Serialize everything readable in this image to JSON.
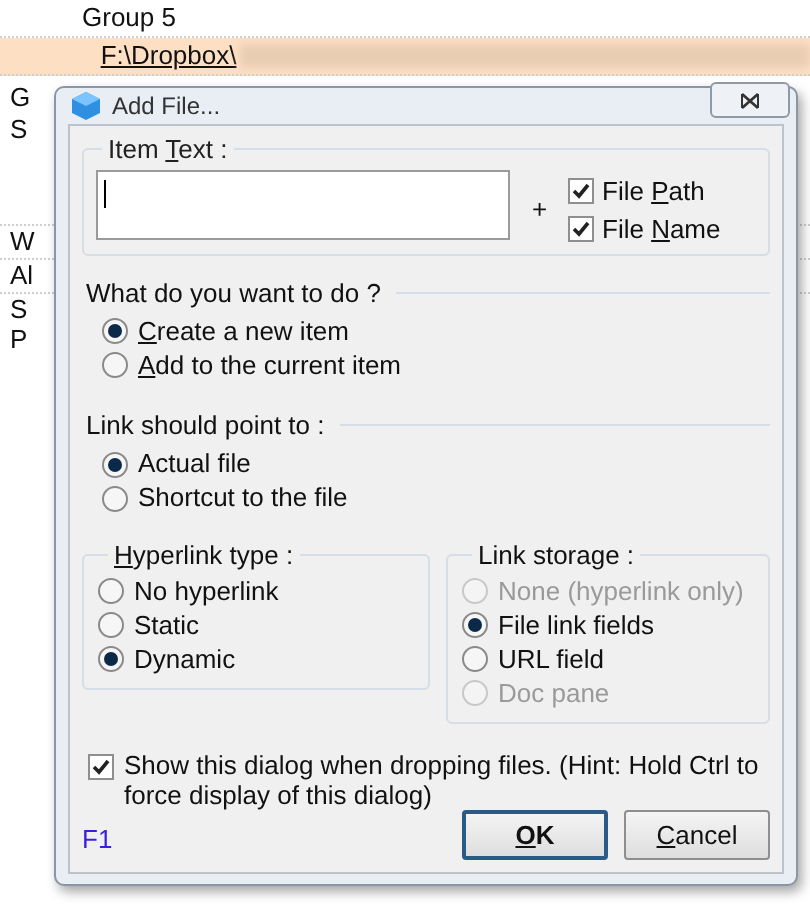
{
  "background_tree": {
    "rows": [
      {
        "label": "Group 5",
        "kind": "group",
        "selected": false
      },
      {
        "label": "F:\\Dropbox\\",
        "kind": "link",
        "selected": true
      }
    ],
    "left_column": [
      "G",
      "S",
      "W",
      "Al",
      "S",
      "P"
    ]
  },
  "dialog": {
    "title": "Add File...",
    "item_text": {
      "label": {
        "pre": "Item ",
        "key": "T",
        "post": "ext :"
      },
      "plus": "+",
      "options": [
        {
          "label": {
            "pre": "File ",
            "key": "P",
            "post": "ath"
          },
          "checked": true
        },
        {
          "label": {
            "pre": "File ",
            "key": "N",
            "post": "ame"
          },
          "checked": true
        }
      ]
    },
    "what_to_do": {
      "title": "What do you want to do ?",
      "options": [
        {
          "label": {
            "key": "C",
            "post": "reate a new item"
          },
          "selected": true
        },
        {
          "label": {
            "key": "A",
            "post": "dd to the current item"
          },
          "selected": false
        }
      ]
    },
    "link_target": {
      "title": "Link should point to :",
      "options": [
        {
          "label": {
            "post": "Actual file"
          },
          "selected": true
        },
        {
          "label": {
            "post": "Shortcut to the file"
          },
          "selected": false
        }
      ]
    },
    "hyperlink_type": {
      "title": {
        "key": "H",
        "post": "yperlink type :"
      },
      "options": [
        {
          "label": {
            "post": "No hyperlink"
          },
          "selected": false,
          "disabled": false
        },
        {
          "label": {
            "post": "Static"
          },
          "selected": false,
          "disabled": false
        },
        {
          "label": {
            "post": "Dynamic"
          },
          "selected": true,
          "disabled": false
        }
      ]
    },
    "link_storage": {
      "title": {
        "post": "Link storage :"
      },
      "options": [
        {
          "label": {
            "post": "None (hyperlink only)"
          },
          "selected": false,
          "disabled": true
        },
        {
          "label": {
            "post": "File link fields"
          },
          "selected": true,
          "disabled": false
        },
        {
          "label": {
            "post": "URL field"
          },
          "selected": false,
          "disabled": false
        },
        {
          "label": {
            "post": "Doc pane"
          },
          "selected": false,
          "disabled": true
        }
      ]
    },
    "show_dialog": {
      "label": "Show this dialog when dropping files. (Hint: Hold Ctrl to force display of this dialog)",
      "checked": true
    },
    "help": "F1",
    "buttons": [
      {
        "label": {
          "key": "O",
          "post": "K"
        },
        "default": true
      },
      {
        "label": {
          "key": "C",
          "post": "ancel"
        },
        "default": false
      }
    ]
  }
}
